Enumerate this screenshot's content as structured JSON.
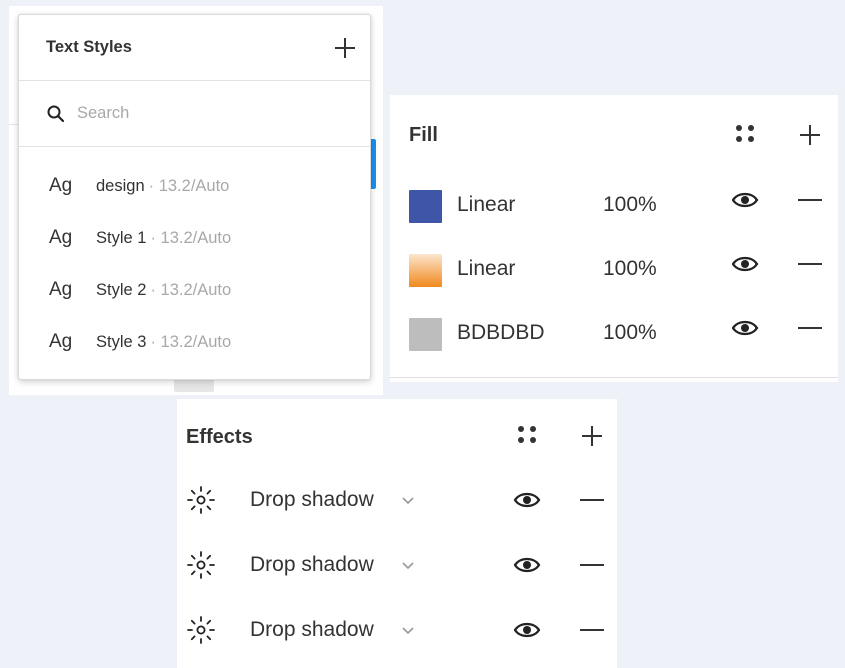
{
  "text_styles": {
    "title": "Text Styles",
    "search_placeholder": "Search",
    "items": [
      {
        "icon": "Ag",
        "name": "design",
        "meta": "· 13.2/Auto"
      },
      {
        "icon": "Ag",
        "name": "Style 1",
        "meta": "· 13.2/Auto"
      },
      {
        "icon": "Ag",
        "name": "Style 2",
        "meta": "· 13.2/Auto"
      },
      {
        "icon": "Ag",
        "name": "Style 3",
        "meta": "· 13.2/Auto"
      }
    ]
  },
  "fill": {
    "title": "Fill",
    "rows": [
      {
        "label": "Linear",
        "opacity": "100%",
        "swatch": "#3f55a8"
      },
      {
        "label": "Linear",
        "opacity": "100%",
        "swatch": "linear-gradient(#fde5cf, #f0891c)"
      },
      {
        "label": "BDBDBD",
        "opacity": "100%",
        "swatch": "#bdbdbd"
      }
    ]
  },
  "effects": {
    "title": "Effects",
    "rows": [
      {
        "label": "Drop shadow"
      },
      {
        "label": "Drop shadow"
      },
      {
        "label": "Drop shadow"
      }
    ]
  },
  "colors": {
    "accent": "#1c8ff0",
    "background": "#eef1f7"
  },
  "icons": [
    "plus-icon",
    "search-icon",
    "style-dots-icon",
    "eye-icon",
    "minus-icon",
    "sun-icon",
    "chevron-down-icon"
  ]
}
